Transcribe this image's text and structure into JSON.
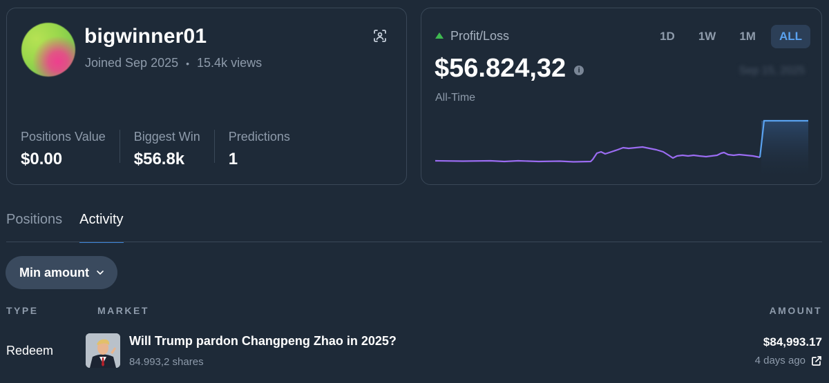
{
  "profile": {
    "username": "bigwinner01",
    "joined": "Joined Sep 2025",
    "separator": "•",
    "views": "15.4k views",
    "stats": [
      {
        "label": "Positions Value",
        "value": "$0.00"
      },
      {
        "label": "Biggest Win",
        "value": "$56.8k"
      },
      {
        "label": "Predictions",
        "value": "1"
      }
    ]
  },
  "pnl": {
    "title": "Profit/Loss",
    "value": "$56.824,32",
    "period": "All-Time",
    "blurred_date": "Sep 15, 2025",
    "ranges": [
      "1D",
      "1W",
      "1M",
      "ALL"
    ],
    "active_range": "ALL",
    "line_color": "#9b6cf2",
    "up_line_color": "#5aa2ef",
    "up_color": "#3fb950"
  },
  "tabs": [
    "Positions",
    "Activity"
  ],
  "active_tab": "Activity",
  "filter": {
    "min_amount_label": "Min amount"
  },
  "table": {
    "headers": {
      "type": "TYPE",
      "market": "MARKET",
      "amount": "AMOUNT"
    },
    "rows": [
      {
        "type": "Redeem",
        "market": "Will Trump pardon Changpeng Zhao in 2025?",
        "shares": "84.993,2 shares",
        "amount": "$84,993.17",
        "time": "4 days ago"
      }
    ]
  }
}
